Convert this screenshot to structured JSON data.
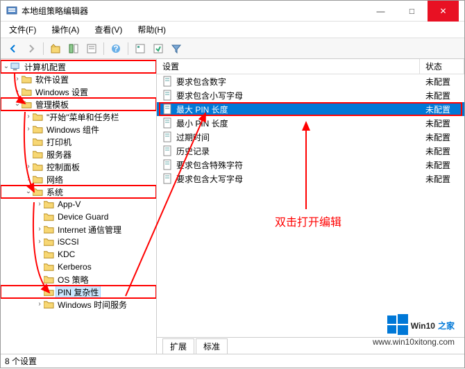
{
  "window": {
    "title": "本地组策略编辑器",
    "min": "—",
    "max": "□",
    "close": "✕"
  },
  "menubar": {
    "file": "文件(F)",
    "action": "操作(A)",
    "view": "查看(V)",
    "help": "帮助(H)"
  },
  "tree": {
    "computer_config": "计算机配置",
    "software_settings": "软件设置",
    "windows_settings": "Windows 设置",
    "admin_templates": "管理模板",
    "start_menu": "\"开始\"菜单和任务栏",
    "windows_components": "Windows 组件",
    "printers": "打印机",
    "servers": "服务器",
    "control_panel": "控制面板",
    "network": "网络",
    "system": "系统",
    "app_v": "App-V",
    "device_guard": "Device Guard",
    "internet_comm": "Internet 通信管理",
    "iscsi": "iSCSI",
    "kdc": "KDC",
    "kerberos": "Kerberos",
    "os_policy": "OS 策略",
    "pin_complexity": "PIN 复杂性",
    "windows_time": "Windows 时间服务"
  },
  "list": {
    "header_setting": "设置",
    "header_state": "状态",
    "rows": {
      "r0": {
        "text": "要求包含数字",
        "state": "未配置"
      },
      "r1": {
        "text": "要求包含小写字母",
        "state": "未配置"
      },
      "r2": {
        "text": "最大 PIN 长度",
        "state": "未配置"
      },
      "r3": {
        "text": "最小 PIN 长度",
        "state": "未配置"
      },
      "r4": {
        "text": "过期时间",
        "state": "未配置"
      },
      "r5": {
        "text": "历史记录",
        "state": "未配置"
      },
      "r6": {
        "text": "要求包含特殊字符",
        "state": "未配置"
      },
      "r7": {
        "text": "要求包含大写字母",
        "state": "未配置"
      }
    }
  },
  "tabs": {
    "extend": "扩展",
    "standard": "标准"
  },
  "statusbar": {
    "count": "8 个设置"
  },
  "annotation": {
    "text": "双击打开编辑"
  },
  "watermark": {
    "brand": "Win10",
    "suffix": "之家",
    "url": "www.win10xitong.com"
  }
}
